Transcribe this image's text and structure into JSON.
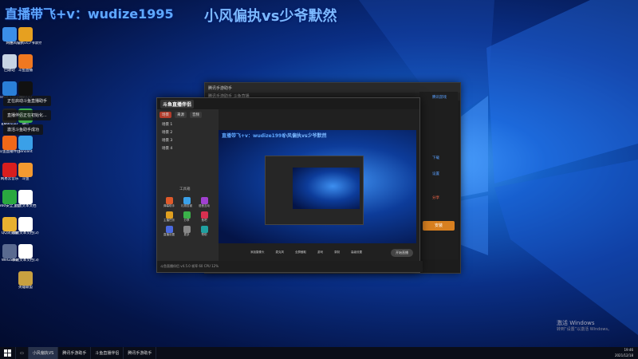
{
  "watermark": {
    "left": "直播带飞+v：wudize1995",
    "center": "小风偏执vs少爷默然"
  },
  "desktop_icons": [
    {
      "label": "网络",
      "icon": "network-icon",
      "color": "#3b8ee8"
    },
    {
      "label": "回收站",
      "icon": "recycle-bin-icon",
      "color": "#c7d4e4"
    },
    {
      "label": "Internet Explorer",
      "icon": "ie-icon",
      "color": "#2a7fd8"
    },
    {
      "label": "小风偏执vs少爷默然",
      "icon": "app-icon",
      "color": "#e6a020"
    },
    {
      "label": "KMPlayer",
      "icon": "kmplayer-icon",
      "color": "#222222"
    },
    {
      "label": "斗鱼直播",
      "icon": "douyu-icon",
      "color": "#f07820"
    },
    {
      "label": "斗鱼直播伴侣",
      "icon": "douyu-companion-icon",
      "color": "#f06818"
    },
    {
      "label": "腾讯QQ",
      "icon": "qq-icon",
      "color": "#111111"
    },
    {
      "label": "网易云音乐",
      "icon": "netease-music-icon",
      "color": "#d81e1e"
    },
    {
      "label": "微信",
      "icon": "wechat-icon",
      "color": "#3bb24a"
    },
    {
      "label": "360安全卫士",
      "icon": "360-icon",
      "color": "#2aa840"
    },
    {
      "label": "Tencent",
      "icon": "tencent-icon",
      "color": "#3aa0e8"
    },
    {
      "label": "QQ浏览器",
      "icon": "qqbrowser-icon",
      "color": "#e8b030"
    },
    {
      "label": "斗鱼",
      "icon": "douyu-small-icon",
      "color": "#f39a30"
    },
    {
      "label": "WeGame",
      "icon": "wegame-icon",
      "color": "#5a6a90"
    },
    {
      "label": "新建文本文档",
      "icon": "text-doc-icon",
      "color": "#ffffff"
    },
    {
      "label": "新建文本文档(2)",
      "icon": "text-doc-icon",
      "color": "#ffffff"
    },
    {
      "label": "新建文本文档(3)",
      "icon": "text-doc-icon",
      "color": "#ffffff"
    },
    {
      "label": "英雄联盟",
      "icon": "lol-icon",
      "color": "#c8a040"
    }
  ],
  "tooltips": [
    "正在启动斗鱼直播助手",
    "直播伴侣正在初始化...",
    "激活斗鱼助手成功"
  ],
  "main_window": {
    "title": "腾讯手游助手",
    "subtitle": "腾讯手游助手 斗鱼直播",
    "right_labels": [
      "腾讯游戏",
      "下载",
      "设置",
      "分享"
    ],
    "right_button": "安装"
  },
  "obs": {
    "logo": "斗鱼直播伴侣",
    "tabs": [
      "场景",
      "来源",
      "音频"
    ],
    "scenes": [
      "场景 1",
      "场景 2",
      "场景 3",
      "场景 4"
    ],
    "section_label": "工具箱",
    "tools": [
      "弹幕助手",
      "礼物答谢",
      "语音互动",
      "主播任务",
      "分享",
      "鱼吧",
      "直播设置",
      "更多",
      "帮助"
    ],
    "controls": [
      "添加摄像头",
      "麦克风",
      "全屏截取",
      "游戏",
      "录制",
      "高级设置"
    ],
    "start_live": "开始直播",
    "status": "斗鱼直播伴侣 v4.5.0  帧率 60  CPU 12%"
  },
  "taskbar": {
    "items": [
      "小风偏执VS",
      "腾讯手游助手",
      "斗鱼直播伴侣",
      "腾讯手游助手"
    ]
  },
  "activation": {
    "line1": "激活 Windows",
    "line2": "转到“设置”以激活 Windows。"
  },
  "clock": {
    "time": "19:46",
    "date": "2021/12/18"
  }
}
